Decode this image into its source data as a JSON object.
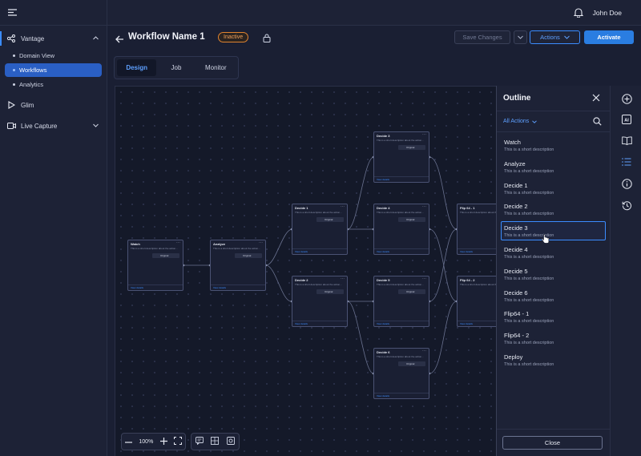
{
  "sidebar": {
    "groups": [
      {
        "label": "Vantage",
        "icon": "share-nodes-icon",
        "expanded": true
      },
      {
        "label": "Glim",
        "icon": "play-icon"
      },
      {
        "label": "Live Capture",
        "icon": "video-camera-icon",
        "expanded": false
      }
    ],
    "vantage_items": [
      "Domain View",
      "Workflows",
      "Analytics"
    ]
  },
  "topbar": {
    "user": "John Doe"
  },
  "header": {
    "title": "Workflow Name 1",
    "status": "Inactive",
    "save_label": "Save Changes",
    "more_label": "⌄",
    "actions_label": "Actions",
    "activate_label": "Activate"
  },
  "tabs": [
    "Design",
    "Job",
    "Monitor"
  ],
  "nodes": {
    "watch": {
      "title": "Watch",
      "desc": "This is a short description about the action...",
      "chip": "Original",
      "foot": "View details"
    },
    "analyze": {
      "title": "Analyze",
      "desc": "This is a short description about the action...",
      "chip": "Original",
      "foot": "View details"
    },
    "decide1": {
      "title": "Decide 1",
      "desc": "This is a short description about the action...",
      "chip": "Original",
      "foot": "View details"
    },
    "decide2": {
      "title": "Decide 2",
      "desc": "This is a short description about the action...",
      "chip": "Original",
      "foot": "View details"
    },
    "decide3": {
      "title": "Decide 3",
      "desc": "This is a short description about the action...",
      "chip": "Original",
      "foot": "View details"
    },
    "decide4": {
      "title": "Decide 4",
      "desc": "This is a short description about the action...",
      "chip": "Original",
      "foot": "View details"
    },
    "decide5": {
      "title": "Decide 5",
      "desc": "This is a short description about the action...",
      "chip": "Original",
      "foot": "View details"
    },
    "decide6": {
      "title": "Decide 6",
      "desc": "This is a short description about the action...",
      "chip": "Original",
      "foot": "View details"
    },
    "flip1": {
      "title": "Flip 64 - 1",
      "desc": "This is a short description about the action...",
      "chip": "Original",
      "foot": "View details"
    },
    "flip2": {
      "title": "Flip 64 - 2",
      "desc": "This is a short description about the action...",
      "chip": "Original",
      "foot": "View details"
    }
  },
  "zoom": {
    "level": "100%"
  },
  "outline": {
    "title": "Outline",
    "filter": "All Actions",
    "items": [
      {
        "name": "Watch",
        "desc": "This is a short description"
      },
      {
        "name": "Analyze",
        "desc": "This is a short description"
      },
      {
        "name": "Decide 1",
        "desc": "This is a short description"
      },
      {
        "name": "Decide 2",
        "desc": "This is a short description"
      },
      {
        "name": "Decide 3",
        "desc": "This is a short description"
      },
      {
        "name": "Decide 4",
        "desc": "This is a short description"
      },
      {
        "name": "Decide 5",
        "desc": "This is a short description"
      },
      {
        "name": "Decide 6",
        "desc": "This is a short description"
      },
      {
        "name": "Flip64 - 1",
        "desc": "This is a short description"
      },
      {
        "name": "Flip64 - 2",
        "desc": "This is a short description"
      },
      {
        "name": "Deploy",
        "desc": "This is a short description"
      }
    ],
    "selected_index": 4,
    "close_label": "Close"
  },
  "rail": {
    "ai_label": "AI",
    "icons": [
      "add-circle-icon",
      "ai-icon",
      "book-icon",
      "list-icon",
      "info-icon",
      "history-icon"
    ]
  },
  "colors": {
    "accent": "#2a7de1",
    "status_inactive": "#e0832f",
    "background": "#1a1f33"
  }
}
